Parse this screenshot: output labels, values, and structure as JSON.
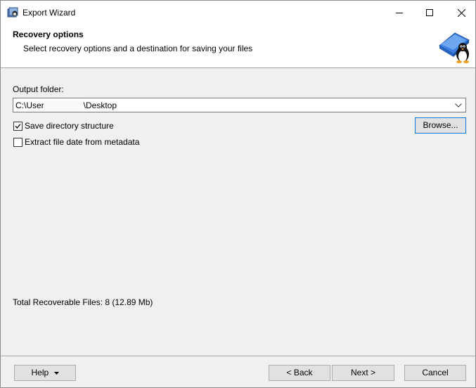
{
  "window": {
    "title": "Export Wizard",
    "icon": "app-icon"
  },
  "header": {
    "title": "Recovery options",
    "subtitle": "Select recovery options and a destination for saving your files",
    "logo": "penguin-logo-icon"
  },
  "output": {
    "label": "Output folder:",
    "value_prefix": "C:\\User",
    "value_suffix": "\\Desktop",
    "browse_label": "Browse..."
  },
  "options": {
    "save_structure": {
      "label": "Save directory structure",
      "checked": true
    },
    "extract_date": {
      "label": "Extract file date from metadata",
      "checked": false
    }
  },
  "summary": {
    "total": "Total Recoverable Files: 8 (12.89 Mb)"
  },
  "footer": {
    "help_label": "Help",
    "back_label": "< Back",
    "next_label": "Next >",
    "cancel_label": "Cancel"
  }
}
